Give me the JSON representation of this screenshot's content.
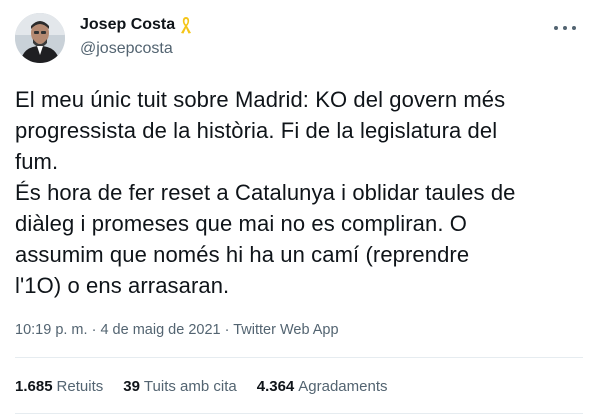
{
  "author": {
    "name": "Josep Costa",
    "handle": "@josepcosta",
    "badge_icon": "yellow-ribbon-icon",
    "ribbon_color": "#f5c518"
  },
  "tweet": {
    "text": "El meu únic tuit sobre Madrid: KO del govern més\nprogressista de la història. Fi de la legislatura del\nfum.\nÉs hora de fer reset a Catalunya i oblidar taules de\ndiàleg i promeses que mai no es compliran. O\nassumim que només hi ha un camí (reprendre\nl'1O) o ens arrasaran.",
    "time": "10:19 p. m.",
    "separator": "·",
    "date": "4 de maig de 2021",
    "source": "Twitter Web App"
  },
  "stats": {
    "retweets_count": "1.685",
    "retweets_label": "Retuits",
    "quotes_count": "39",
    "quotes_label": "Tuits amb cita",
    "likes_count": "4.364",
    "likes_label": "Agradaments"
  },
  "colors": {
    "text": "#0f1419",
    "secondary": "#536471",
    "divider": "#e6ecf0"
  }
}
